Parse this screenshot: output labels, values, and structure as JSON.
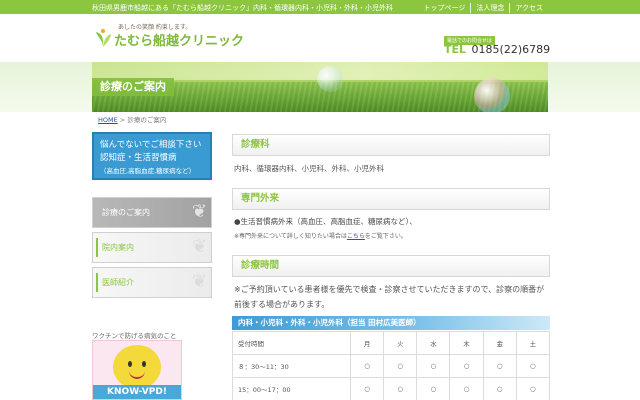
{
  "topbar": {
    "description": "秋田県男鹿市船越にある「たむら船越クリニック」内科・循環器内科・小児科・外科・小児外科",
    "nav": [
      "トップページ",
      "法人理念",
      "アクセス"
    ]
  },
  "header": {
    "tagline": "あしたの笑顔 約束します。",
    "clinic_name": "たむら船越クリニック",
    "phone_label": "電話でのお問合せは",
    "phone_prefix": "TEL",
    "phone_number": "0185(22)6789"
  },
  "banner": {
    "title": "診療のご案内"
  },
  "breadcrumb": {
    "home": "HOME",
    "separator": " > ",
    "current": "診療のご案内"
  },
  "sidebar": {
    "feature": {
      "line1": "悩んでないでご相談下さい",
      "line2": "認知症・生活習慣病",
      "line3": "（高血圧,高脂血症,糖尿病など）"
    },
    "items": [
      {
        "label": "診療のご案内",
        "active": true
      },
      {
        "label": "院内案内",
        "active": false
      },
      {
        "label": "医師紹介",
        "active": false
      }
    ],
    "vaccine_caption": "ワクチンで防げる病気のこと",
    "vaccine_banner": "KNOW-VPD!"
  },
  "main": {
    "section1": {
      "heading": "診療科",
      "text": "内科、循環器内科、小児科、外科、小児外科"
    },
    "section2": {
      "heading": "専門外来",
      "text": "●生活習慣病外来（高血圧、高脂血症、糖尿病など）、",
      "note_before": "※専門外来について詳しく知りたい場合は",
      "note_link": "こちら",
      "note_after": "をご覧下さい。"
    },
    "section3": {
      "heading": "診療時間",
      "text": "※ご予約頂いている患者様を優先で検査・診察させていただきますので、診察の順番が前後する場合があります。"
    },
    "schedule": {
      "title": "内科・小児科・外科・小児外科（担当 田村広美医師）",
      "header": [
        "受付時間",
        "月",
        "火",
        "水",
        "木",
        "金",
        "土"
      ],
      "rows": [
        [
          "８：30～11：30",
          "○",
          "○",
          "○",
          "○",
          "○",
          "○"
        ],
        [
          "15：00～17：00",
          "○",
          "○",
          "○",
          "○",
          "○",
          "○"
        ]
      ]
    }
  },
  "colors": {
    "accent_green": "#8cc63f",
    "accent_blue": "#3a9bd2"
  }
}
